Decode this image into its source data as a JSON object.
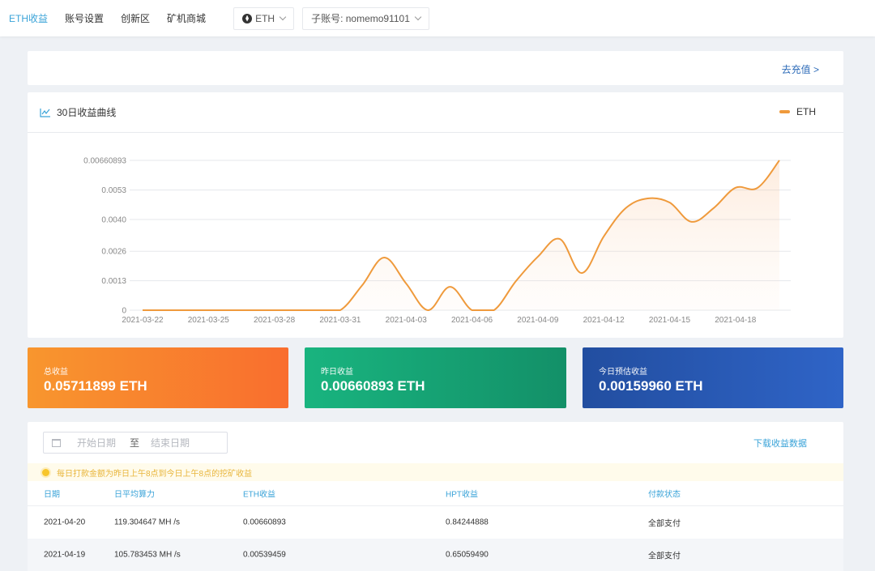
{
  "topnav": {
    "items": [
      {
        "label": "ETH收益",
        "active": true
      },
      {
        "label": "账号设置",
        "active": false
      },
      {
        "label": "创新区",
        "active": false
      },
      {
        "label": "矿机商城",
        "active": false
      }
    ],
    "coin_select": {
      "value": "ETH",
      "icon": "eth-coin-icon"
    },
    "subaccount_select": {
      "value": "子账号: nomemo91101"
    }
  },
  "recharge": {
    "link_label": "去充值 >"
  },
  "chart_panel": {
    "title": "30日收益曲线",
    "title_icon": "line-chart-icon",
    "legend_label": "ETH"
  },
  "chart_data": {
    "type": "area",
    "title": "30日收益曲线",
    "xlabel": "",
    "ylabel": "",
    "series": [
      {
        "name": "ETH",
        "color": "#ef9a3c",
        "values": [
          0,
          0,
          0,
          0,
          0,
          0,
          0,
          0,
          0,
          0,
          0.0011,
          0.00232,
          0.00118,
          0,
          0.00103,
          0,
          0,
          0.00128,
          0.00236,
          0.00314,
          0.00164,
          0.00325,
          0.0045,
          0.00493,
          0.00475,
          0.0039,
          0.0045,
          0.0054,
          0.00539459,
          0.00660893
        ]
      }
    ],
    "x": [
      "2021-03-22",
      "2021-03-23",
      "2021-03-24",
      "2021-03-25",
      "2021-03-26",
      "2021-03-27",
      "2021-03-28",
      "2021-03-29",
      "2021-03-30",
      "2021-03-31",
      "2021-04-01",
      "2021-04-02",
      "2021-04-03",
      "2021-04-04",
      "2021-04-05",
      "2021-04-06",
      "2021-04-07",
      "2021-04-08",
      "2021-04-09",
      "2021-04-10",
      "2021-04-11",
      "2021-04-12",
      "2021-04-13",
      "2021-04-14",
      "2021-04-15",
      "2021-04-16",
      "2021-04-17",
      "2021-04-18",
      "2021-04-19",
      "2021-04-20"
    ],
    "x_tick_labels": [
      "2021-03-22",
      "2021-03-25",
      "2021-03-28",
      "2021-03-31",
      "2021-04-03",
      "2021-04-06",
      "2021-04-09",
      "2021-04-12",
      "2021-04-15",
      "2021-04-18"
    ],
    "y_ticks": [
      0,
      0.0013,
      0.0026,
      0.004,
      0.0053,
      0.00660893
    ],
    "y_tick_labels": [
      "0",
      "0.0013",
      "0.0026",
      "0.0040",
      "0.0053",
      "0.00660893"
    ],
    "ylim": [
      0,
      0.00660893
    ],
    "grid": true,
    "legend": "top-right"
  },
  "stats": [
    {
      "label": "总收益",
      "value": "0.05711899 ETH"
    },
    {
      "label": "昨日收益",
      "value": "0.00660893 ETH"
    },
    {
      "label": "今日预估收益",
      "value": "0.00159960 ETH"
    }
  ],
  "filter": {
    "start_placeholder": "开始日期",
    "separator": "至",
    "end_placeholder": "结束日期",
    "download_label": "下载收益数据"
  },
  "notice": {
    "text": "每日打款金额为昨日上午8点到今日上午8点的挖矿收益"
  },
  "table": {
    "columns": [
      "日期",
      "日平均算力",
      "ETH收益",
      "HPT收益",
      "付款状态"
    ],
    "rows": [
      [
        "2021-04-20",
        "119.304647 MH /s",
        "0.00660893",
        "0.84244888",
        "全部支付"
      ],
      [
        "2021-04-19",
        "105.783453 MH /s",
        "0.00539459",
        "0.65059490",
        "全部支付"
      ]
    ]
  }
}
